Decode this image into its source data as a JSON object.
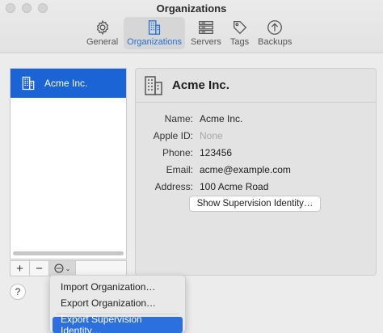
{
  "window": {
    "title": "Organizations"
  },
  "toolbar": {
    "tabs": [
      {
        "label": "General",
        "icon": "gear-icon"
      },
      {
        "label": "Organizations",
        "icon": "building-icon",
        "active": true
      },
      {
        "label": "Servers",
        "icon": "server-icon"
      },
      {
        "label": "Tags",
        "icon": "tag-icon"
      },
      {
        "label": "Backups",
        "icon": "upload-arrow-icon"
      }
    ]
  },
  "sidebar": {
    "items": [
      {
        "label": "Acme Inc.",
        "icon": "building-icon",
        "selected": true
      }
    ],
    "buttons": {
      "add": "+",
      "remove": "−",
      "action_icon": "ellipsis-circle-icon",
      "action_chevron": "⌄"
    }
  },
  "details": {
    "title": "Acme Inc.",
    "fields": [
      {
        "label": "Name:",
        "value": "Acme Inc."
      },
      {
        "label": "Apple ID:",
        "value": "None",
        "dim": true
      },
      {
        "label": "Phone:",
        "value": "123456"
      },
      {
        "label": "Email:",
        "value": "acme@example.com"
      },
      {
        "label": "Address:",
        "value": "100 Acme Road"
      }
    ],
    "supervision_button": "Show Supervision Identity…"
  },
  "help": {
    "label": "?"
  },
  "menu": {
    "items": [
      {
        "label": "Import Organization…"
      },
      {
        "label": "Export Organization…"
      },
      {
        "label": "Export Supervision Identity…",
        "highlighted": true
      }
    ]
  },
  "colors": {
    "accent": "#1a64d6",
    "highlight": "#2c6fde"
  }
}
